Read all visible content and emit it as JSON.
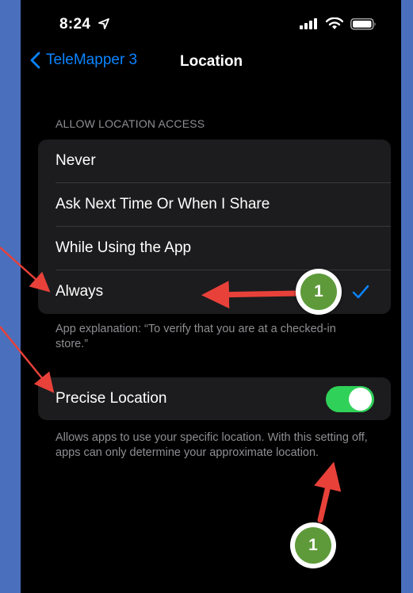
{
  "status_bar": {
    "time": "8:24"
  },
  "nav": {
    "back_label": "TeleMapper 3",
    "title": "Location"
  },
  "section_header": "ALLOW LOCATION ACCESS",
  "options": [
    {
      "label": "Never"
    },
    {
      "label": "Ask Next Time Or When I Share"
    },
    {
      "label": "While Using the App"
    },
    {
      "label": "Always",
      "selected": true
    }
  ],
  "app_explanation": "App explanation: “To verify that you are at a checked-in store.”",
  "precise_location": {
    "label": "Precise Location",
    "enabled": true
  },
  "precise_footer": "Allows apps to use your specific location. With this setting off, apps can only determine your approximate location.",
  "annotations": [
    {
      "badge": "1"
    },
    {
      "badge": "1"
    }
  ],
  "colors": {
    "background": "#4a6fbd",
    "accent": "#0a84ff",
    "toggle_on": "#30d158",
    "annotation_arrow": "#e8413a",
    "badge": "#5e9a3a"
  }
}
